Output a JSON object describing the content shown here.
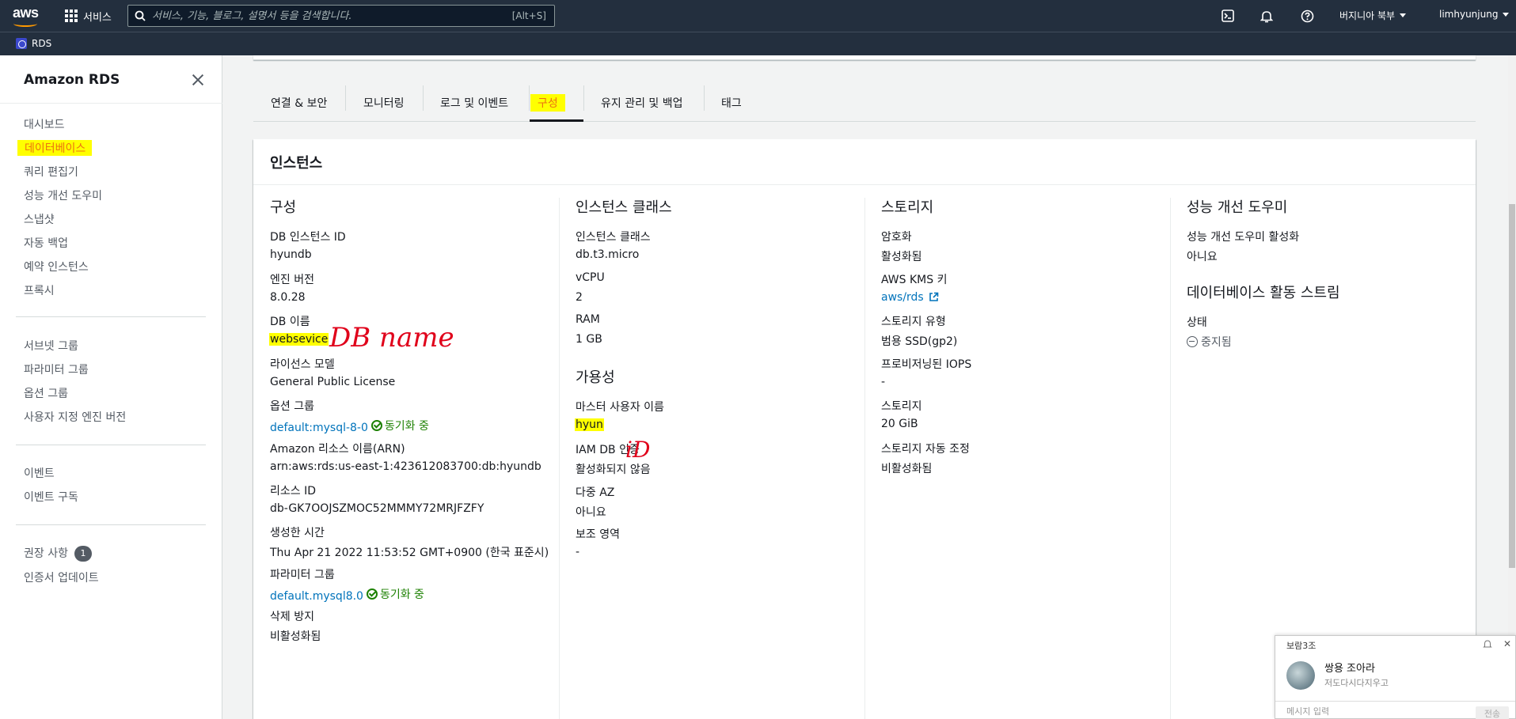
{
  "topbar": {
    "logo": "aws",
    "services_label": "서비스",
    "search_placeholder": "서비스, 기능, 블로그, 설명서 등을 검색합니다.",
    "search_shortcut": "[Alt+S]",
    "icons": [
      "cloudshell-icon",
      "bell-icon",
      "help-icon"
    ],
    "region": "버지니아 북부",
    "user": "limhyunjung"
  },
  "subbar": {
    "service": "RDS"
  },
  "sidebar": {
    "title": "Amazon RDS",
    "group1": [
      "대시보드",
      "데이터베이스",
      "쿼리 편집기",
      "성능 개선 도우미",
      "스냅샷",
      "자동 백업",
      "예약 인스턴스",
      "프록시"
    ],
    "active_item": "데이터베이스",
    "group2": [
      "서브넷 그룹",
      "파라미터 그룹",
      "옵션 그룹",
      "사용자 지정 엔진 버전"
    ],
    "group3": [
      "이벤트",
      "이벤트 구독"
    ],
    "group4": [
      "권장 사항",
      "인증서 업데이트"
    ],
    "recommendation_count": "1"
  },
  "tabs": [
    "연결 & 보안",
    "모니터링",
    "로그 및 이벤트",
    "구성",
    "유지 관리 및 백업",
    "태그"
  ],
  "active_tab": "구성",
  "card": {
    "title": "인스턴스",
    "col1": {
      "heading": "구성",
      "fields": [
        {
          "label": "DB 인스턴스 ID",
          "value": "hyundb"
        },
        {
          "label": "엔진 버전",
          "value": "8.0.28"
        },
        {
          "label": "DB 이름",
          "value": "websevice"
        },
        {
          "label": "라이선스 모델",
          "value": "General Public License"
        },
        {
          "label": "옵션 그룹",
          "value": "default:mysql-8-0",
          "status": "동기화 중"
        },
        {
          "label": "Amazon 리소스 이름(ARN)",
          "value": "arn:aws:rds:us-east-1:423612083700:db:hyundb"
        },
        {
          "label": "리소스 ID",
          "value": "db-GK7OOJSZMOC52MMMY72MRJFZFY"
        },
        {
          "label": "생성한 시간",
          "value": "Thu Apr 21 2022 11:53:52 GMT+0900 (한국 표준시)"
        },
        {
          "label": "파라미터 그룹",
          "value": "default.mysql8.0",
          "status": "동기화 중"
        },
        {
          "label": "삭제 방지",
          "value": "비활성화됨"
        }
      ]
    },
    "col2": {
      "heading": "인스턴스 클래스",
      "fields": [
        {
          "label": "인스턴스 클래스",
          "value": "db.t3.micro"
        },
        {
          "label": "vCPU",
          "value": "2"
        },
        {
          "label": "RAM",
          "value": "1 GB"
        }
      ],
      "heading2": "가용성",
      "fields2": [
        {
          "label": "마스터 사용자 이름",
          "value": "hyun"
        },
        {
          "label": "IAM DB 인증",
          "value": "활성화되지 않음"
        },
        {
          "label": "다중 AZ",
          "value": "아니요"
        },
        {
          "label": "보조 영역",
          "value": "-"
        }
      ]
    },
    "col3": {
      "heading": "스토리지",
      "fields": [
        {
          "label": "암호화",
          "value": "활성화됨"
        },
        {
          "label": "AWS KMS 키",
          "value": "aws/rds"
        },
        {
          "label": "스토리지 유형",
          "value": "범용 SSD(gp2)"
        },
        {
          "label": "프로비저닝된 IOPS",
          "value": "-"
        },
        {
          "label": "스토리지",
          "value": "20 GiB"
        },
        {
          "label": "스토리지 자동 조정",
          "value": "비활성화됨"
        }
      ]
    },
    "col4": {
      "heading": "성능 개선 도우미",
      "fields": [
        {
          "label": "성능 개선 도우미 활성화",
          "value": "아니요"
        }
      ],
      "heading2": "데이터베이스 활동 스트림",
      "fields2": [
        {
          "label": "상태",
          "value": "중지됨"
        }
      ]
    }
  },
  "annotations": {
    "db_name": "DB name",
    "id": "iD"
  },
  "chat": {
    "title": "보람3조",
    "name": "쌍용 조아라",
    "message": "저도다시다지우고",
    "input_placeholder": "메시지 입력",
    "send_label": "전송"
  },
  "colors": {
    "nav": "#232f3e",
    "accent": "#ec7211",
    "link": "#0073bb",
    "success": "#1d8102",
    "highlight": "#ffff00",
    "annotation": "#e0001a"
  }
}
